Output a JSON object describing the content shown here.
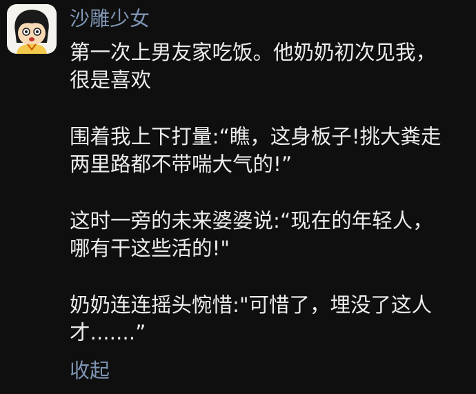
{
  "post": {
    "username": "沙雕少女",
    "avatar_icon": "cartoon-girl-avatar-icon",
    "paragraphs": [
      {
        "lines": [
          "第一次上男友家吃饭。他奶奶初次见我，",
          "很是喜欢"
        ]
      },
      {
        "lines": [
          "围着我上下打量:“瞧，这身板子!挑大粪走",
          "两里路都不带喘大气的!”"
        ]
      },
      {
        "lines": [
          "这时一旁的未来婆婆说:“现在的年轻人，",
          "哪有干这些活的!\""
        ]
      },
      {
        "lines": [
          "奶奶连连摇头惋惜:\"可惜了，埋没了这人",
          "才.......”"
        ]
      }
    ],
    "collapse_label": "收起"
  },
  "colors": {
    "background": "#0f0f0f",
    "text": "#ececec",
    "accent_link": "#7f95b5",
    "avatar_bg": "#f4f3ee"
  }
}
